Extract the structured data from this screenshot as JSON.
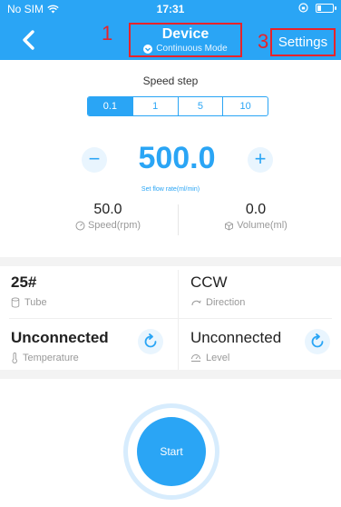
{
  "status_bar": {
    "carrier": "No SIM",
    "time": "17:31"
  },
  "header": {
    "title": "Device",
    "mode": "Continuous Mode",
    "settings_label": "Settings"
  },
  "annotations": {
    "a1": "1",
    "a3": "3"
  },
  "speed_step": {
    "label": "Speed step",
    "options": [
      "0.1",
      "1",
      "5",
      "10"
    ],
    "selected": "0.1"
  },
  "flow": {
    "value": "500.0",
    "label": "Set flow rate(ml/min)",
    "minus": "−",
    "plus": "+"
  },
  "metrics": {
    "speed_value": "50.0",
    "speed_label": "Speed(rpm)",
    "volume_value": "0.0",
    "volume_label": "Volume(ml)"
  },
  "info": {
    "tube_value": "25#",
    "tube_label": "Tube",
    "direction_value": "CCW",
    "direction_label": "Direction",
    "temperature_value": "Unconnected",
    "temperature_label": "Temperature",
    "level_value": "Unconnected",
    "level_label": "Level"
  },
  "start_label": "Start",
  "colors": {
    "accent": "#2aa5f5",
    "annotation": "#e8232a"
  }
}
